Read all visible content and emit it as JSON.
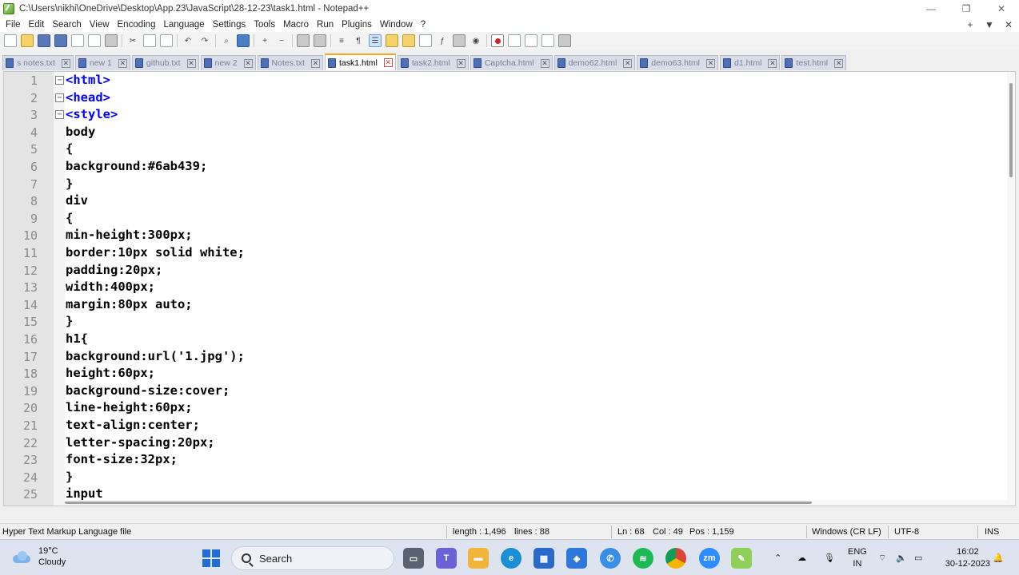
{
  "window": {
    "title": "C:\\Users\\nikhi\\OneDrive\\Desktop\\App.23\\JavaScript\\28-12-23\\task1.html - Notepad++",
    "minimize": "—",
    "maximize": "❐",
    "close": "✕"
  },
  "menu": {
    "items": [
      "File",
      "Edit",
      "Search",
      "View",
      "Encoding",
      "Language",
      "Settings",
      "Tools",
      "Macro",
      "Run",
      "Plugins",
      "Window",
      "?"
    ],
    "right_icons": [
      "+",
      "▼",
      "✕"
    ]
  },
  "tabs": [
    {
      "label": "s notes.txt",
      "active": false
    },
    {
      "label": "new 1",
      "active": false
    },
    {
      "label": "github.txt",
      "active": false
    },
    {
      "label": "new 2",
      "active": false
    },
    {
      "label": "Notes.txt",
      "active": false
    },
    {
      "label": "task1.html",
      "active": true
    },
    {
      "label": "task2.html",
      "active": false
    },
    {
      "label": "Captcha.html",
      "active": false
    },
    {
      "label": "demo62.html",
      "active": false
    },
    {
      "label": "demo63.html",
      "active": false
    },
    {
      "label": "d1.html",
      "active": false
    },
    {
      "label": "test.html",
      "active": false
    }
  ],
  "editor": {
    "lines": [
      {
        "n": "1",
        "text": "<html>",
        "kind": "tag",
        "fold": "−"
      },
      {
        "n": "2",
        "text": "<head>",
        "kind": "tag",
        "fold": "−"
      },
      {
        "n": "3",
        "text": "<style>",
        "kind": "tag",
        "fold": "−"
      },
      {
        "n": "4",
        "text": "body",
        "kind": "plain",
        "fold": ""
      },
      {
        "n": "5",
        "text": "{",
        "kind": "plain",
        "fold": ""
      },
      {
        "n": "6",
        "text": "background:#6ab439;",
        "kind": "plain",
        "fold": ""
      },
      {
        "n": "7",
        "text": "}",
        "kind": "plain",
        "fold": ""
      },
      {
        "n": "8",
        "text": "div",
        "kind": "plain",
        "fold": ""
      },
      {
        "n": "9",
        "text": "{",
        "kind": "plain",
        "fold": ""
      },
      {
        "n": "10",
        "text": "min-height:300px;",
        "kind": "plain",
        "fold": ""
      },
      {
        "n": "11",
        "text": "border:10px solid white;",
        "kind": "plain",
        "fold": ""
      },
      {
        "n": "12",
        "text": "padding:20px;",
        "kind": "plain",
        "fold": ""
      },
      {
        "n": "13",
        "text": "width:400px;",
        "kind": "plain",
        "fold": ""
      },
      {
        "n": "14",
        "text": "margin:80px auto;",
        "kind": "plain",
        "fold": ""
      },
      {
        "n": "15",
        "text": "}",
        "kind": "plain",
        "fold": ""
      },
      {
        "n": "16",
        "text": "h1{",
        "kind": "plain",
        "fold": ""
      },
      {
        "n": "17",
        "text": "background:url('1.jpg');",
        "kind": "plain",
        "fold": ""
      },
      {
        "n": "18",
        "text": "height:60px;",
        "kind": "plain",
        "fold": ""
      },
      {
        "n": "19",
        "text": "background-size:cover;",
        "kind": "plain",
        "fold": ""
      },
      {
        "n": "20",
        "text": "line-height:60px;",
        "kind": "plain",
        "fold": ""
      },
      {
        "n": "21",
        "text": "text-align:center;",
        "kind": "plain",
        "fold": ""
      },
      {
        "n": "22",
        "text": "letter-spacing:20px;",
        "kind": "plain",
        "fold": ""
      },
      {
        "n": "23",
        "text": "font-size:32px;",
        "kind": "plain",
        "fold": ""
      },
      {
        "n": "24",
        "text": "}",
        "kind": "plain",
        "fold": ""
      },
      {
        "n": "25",
        "text": "input",
        "kind": "plain",
        "fold": ""
      }
    ],
    "colors": {
      "tag": "#0000ff",
      "plain": "#000000",
      "gutter": "#e4e4e4"
    }
  },
  "status": {
    "file_type": "Hyper Text Markup Language file",
    "length": "length : 1,496",
    "lines": "lines : 88",
    "ln": "Ln : 68",
    "col": "Col : 49",
    "pos": "Pos : 1,159",
    "eol": "Windows (CR LF)",
    "encoding": "UTF-8",
    "mode": "INS"
  },
  "taskbar": {
    "temperature": "19°C",
    "weather": "Cloudy",
    "search_label": "Search",
    "lang_top": "ENG",
    "lang_bottom": "IN",
    "time": "16:02",
    "date": "30-12-2023",
    "apps": [
      "file-explorer",
      "teams",
      "folder",
      "edge",
      "store",
      "photos",
      "messenger",
      "spotify",
      "chrome",
      "zoom",
      "notepadpp"
    ]
  }
}
